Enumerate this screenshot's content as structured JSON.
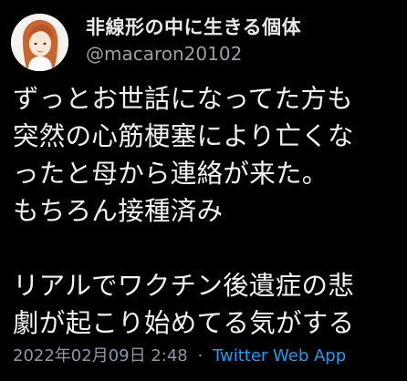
{
  "user": {
    "display_name": "非線形の中に生きる個体",
    "handle": "@macaron20102"
  },
  "tweet": {
    "lines": [
      "ずっとお世話になってた方も",
      "突然の心筋梗塞により亡くな",
      "ったと母から連絡が来た。",
      "もちろん接種済み",
      "",
      "リアルでワクチン後遺症の悲",
      "劇が起こり始めてる気がする"
    ]
  },
  "meta": {
    "timestamp": "2022年02月09日 2:48",
    "separator": "·",
    "source": "Twitter Web App"
  },
  "colors": {
    "background": "#000000",
    "text": "#e7e9ea",
    "secondary": "#8b98a5",
    "link": "#1d9bf0"
  }
}
